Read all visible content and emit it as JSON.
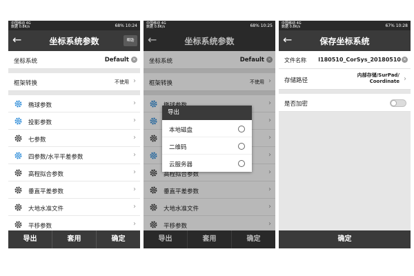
{
  "statusbar": {
    "left_line1": "中国移动 4G",
    "left_line2": "数据 0.8K/s",
    "screen1_time": "68% 10:24",
    "screen2_time": "68% 10:25",
    "screen3_time": "67% 10:28"
  },
  "screen1": {
    "title": "坐标系统参数",
    "help_label": "帮助",
    "coord_system_label": "坐标系统",
    "coord_system_value": "Default",
    "frame_transform_label": "框架转换",
    "frame_transform_value": "不使用",
    "items": [
      {
        "label": "椭球参数",
        "icon": "gear-icon"
      },
      {
        "label": "投影参数",
        "icon": "gear-icon"
      },
      {
        "label": "七参数",
        "icon": "gear-icon"
      },
      {
        "label": "四参数/水平平差参数",
        "icon": "gear-icon"
      },
      {
        "label": "高程拟合参数",
        "icon": "gear-icon"
      },
      {
        "label": "垂直平差参数",
        "icon": "gear-icon"
      },
      {
        "label": "大地水准文件",
        "icon": "gear-icon"
      },
      {
        "label": "平移参数",
        "icon": "gear-icon"
      }
    ],
    "bottom": {
      "export": "导出",
      "apply": "套用",
      "confirm": "确定"
    }
  },
  "screen2": {
    "popup_title": "导出",
    "options": [
      "本地磁盘",
      "二维码",
      "云服务器"
    ]
  },
  "screen3": {
    "title": "保存坐标系统",
    "filename_label": "文件名称",
    "filename_value": "l180510_CorSys_20180510",
    "path_label": "存储路径",
    "path_line1": "内部存储/SurPad/",
    "path_line2": "Coordinate",
    "encrypt_label": "是否加密",
    "confirm_label": "确定"
  },
  "colors": {
    "appbar": "#3a3a3a",
    "accent_gear": "#2a8ad8",
    "dark_gear": "#333333"
  }
}
